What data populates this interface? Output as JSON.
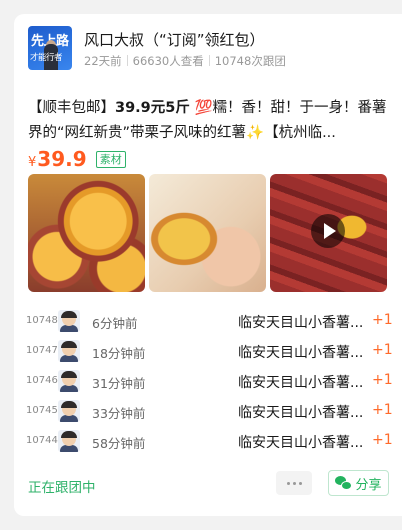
{
  "group": {
    "title": "风口大叔（“订阅”领红包）",
    "avatar_text_line1": "先上路",
    "avatar_text_line2": "才能行者",
    "posted": "22天前",
    "views": "66630人查看",
    "joined": "10748次跟团"
  },
  "product": {
    "desc_prefix": "【顺丰包邮】",
    "desc_bold": "39.9元5斤",
    "desc_rest": " 💯糯！香！甜！于一身！番薯界的“网红新贵”带栗子风味的红薯✨【杭州临...",
    "currency": "¥",
    "price": "39.9",
    "tag": "素材"
  },
  "photos": [
    {
      "icon": "sweet-potato-halves"
    },
    {
      "icon": "sweet-potato-peeled"
    },
    {
      "icon": "sweet-potato-pile",
      "video": true
    }
  ],
  "orders": [
    {
      "num": "10748",
      "time": "6分钟前",
      "product": "临安天目山小香薯...",
      "qty": "+1"
    },
    {
      "num": "10747",
      "time": "18分钟前",
      "product": "临安天目山小香薯...",
      "qty": "+1"
    },
    {
      "num": "10746",
      "time": "31分钟前",
      "product": "临安天目山小香薯...",
      "qty": "+1"
    },
    {
      "num": "10745",
      "time": "33分钟前",
      "product": "临安天目山小香薯...",
      "qty": "+1"
    },
    {
      "num": "10744",
      "time": "58分钟前",
      "product": "临安天目山小香薯...",
      "qty": "+1"
    }
  ],
  "footer": {
    "status": "正在跟团中",
    "share_label": "分享"
  },
  "colors": {
    "accent_green": "#2fb26a",
    "price_orange": "#ff5a1f"
  }
}
